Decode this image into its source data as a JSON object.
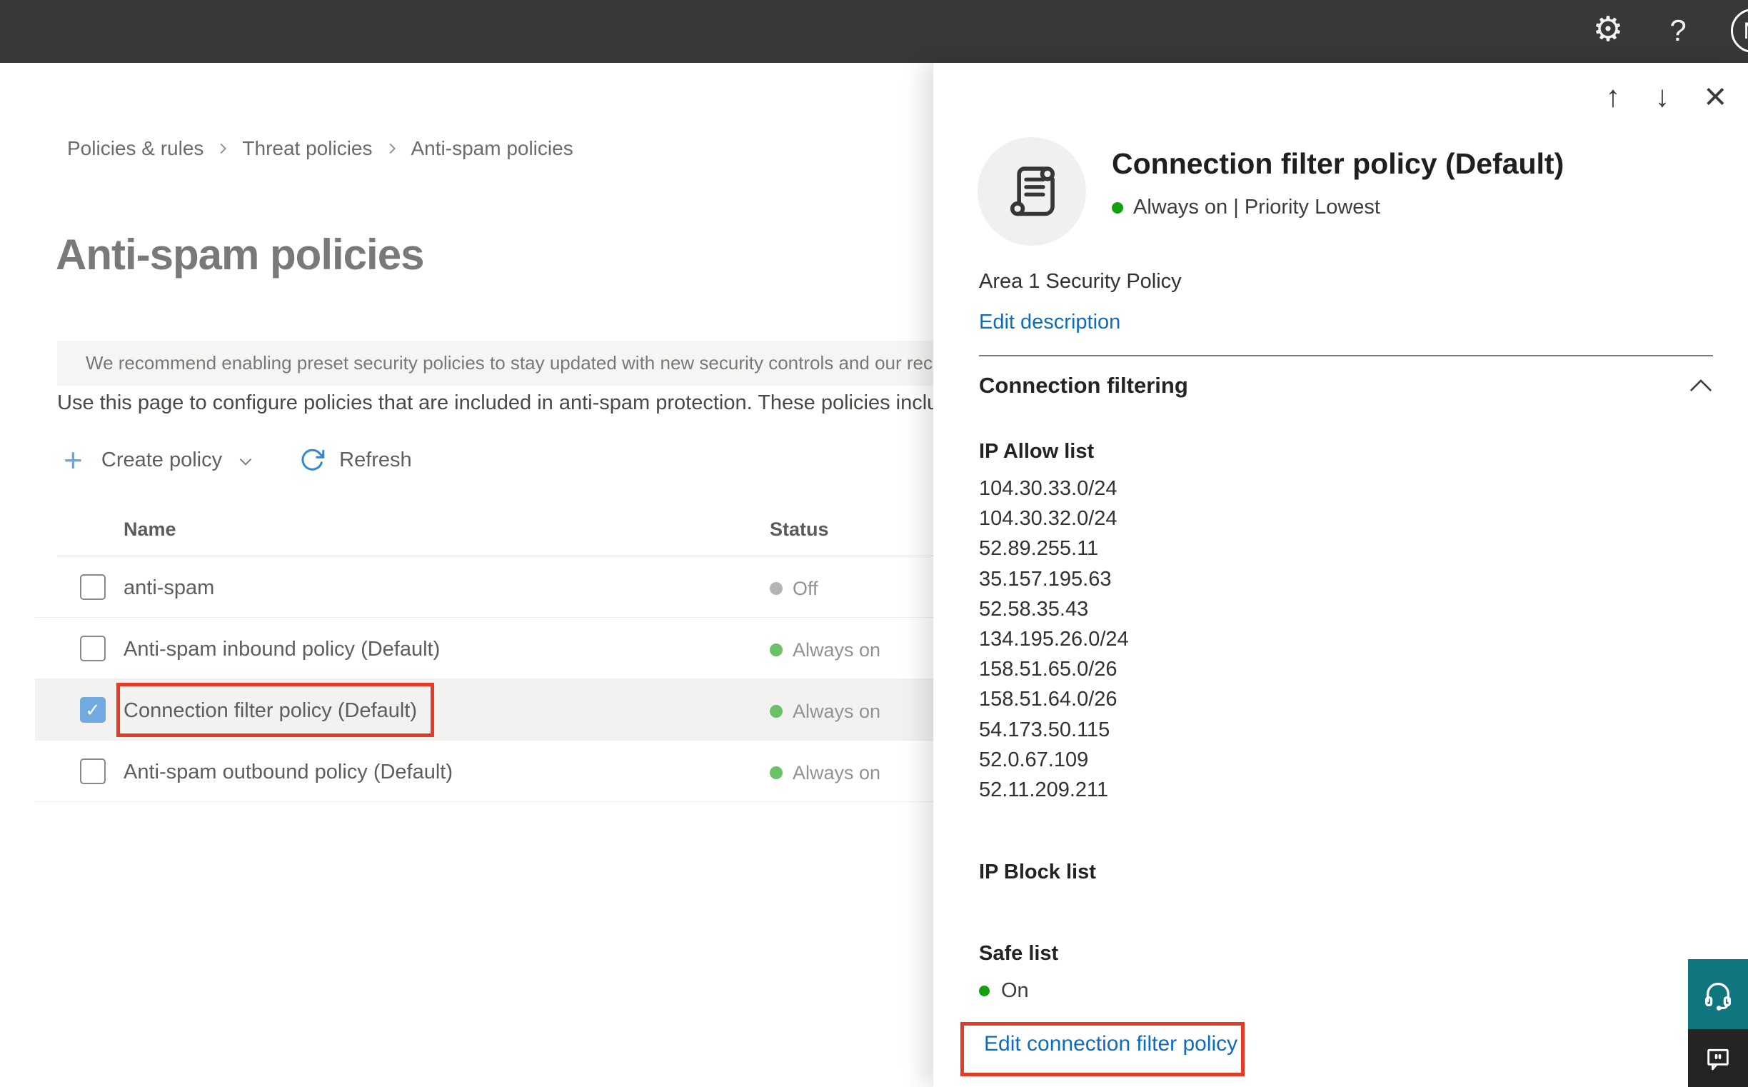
{
  "topbar": {
    "gear_glyph": "⚙",
    "help_glyph": "?",
    "avatar_initial": "M"
  },
  "breadcrumb": {
    "items": [
      "Policies & rules",
      "Threat policies",
      "Anti-spam policies"
    ]
  },
  "page": {
    "title": "Anti-spam policies",
    "banner_text": "We recommend enabling preset security policies to stay updated with new security controls and our recommen",
    "intro_text": "Use this page to configure policies that are included in anti-spam protection. These policies include"
  },
  "toolbar": {
    "plus_glyph": "+",
    "create_label": "Create policy",
    "refresh_label": "Refresh"
  },
  "table": {
    "columns": {
      "name": "Name",
      "status": "Status"
    },
    "rows": [
      {
        "name": "anti-spam",
        "status": "Off",
        "status_color": "gray",
        "checked": false,
        "selected": false,
        "annotated": false
      },
      {
        "name": "Anti-spam inbound policy (Default)",
        "status": "Always on",
        "status_color": "green",
        "checked": false,
        "selected": false,
        "annotated": false
      },
      {
        "name": "Connection filter policy (Default)",
        "status": "Always on",
        "status_color": "green",
        "checked": true,
        "selected": true,
        "annotated": true
      },
      {
        "name": "Anti-spam outbound policy (Default)",
        "status": "Always on",
        "status_color": "green",
        "checked": false,
        "selected": false,
        "annotated": false
      }
    ],
    "check_glyph": "✓"
  },
  "panel": {
    "up_glyph": "↑",
    "down_glyph": "↓",
    "close_glyph": "×",
    "title": "Connection filter policy (Default)",
    "status_line": "Always on | Priority Lowest",
    "description": "Area 1 Security Policy",
    "edit_description_label": "Edit description",
    "section_title": "Connection filtering",
    "ip_allow": {
      "title": "IP Allow list",
      "entries": [
        "104.30.33.0/24",
        "104.30.32.0/24",
        "52.89.255.11",
        "35.157.195.63",
        "52.58.35.43",
        "134.195.26.0/24",
        "158.51.65.0/26",
        "158.51.64.0/26",
        "54.173.50.115",
        "52.0.67.109",
        "52.11.209.211"
      ]
    },
    "ip_block": {
      "title": "IP Block list"
    },
    "safe_list": {
      "title": "Safe list",
      "value": "On"
    },
    "edit_link_label": "Edit connection filter policy"
  },
  "colors": {
    "topbar": "#3a3836",
    "accent_link_blue": "#0f6cbd",
    "checkbox_blue": "#71aade",
    "status_green_soft": "#6cc067",
    "status_green_vivid": "#13a10e",
    "status_gray": "#b6b4b2",
    "annotation_red": "#e23b26",
    "support_teal": "#0f7680",
    "feedback_dark": "#252423"
  }
}
